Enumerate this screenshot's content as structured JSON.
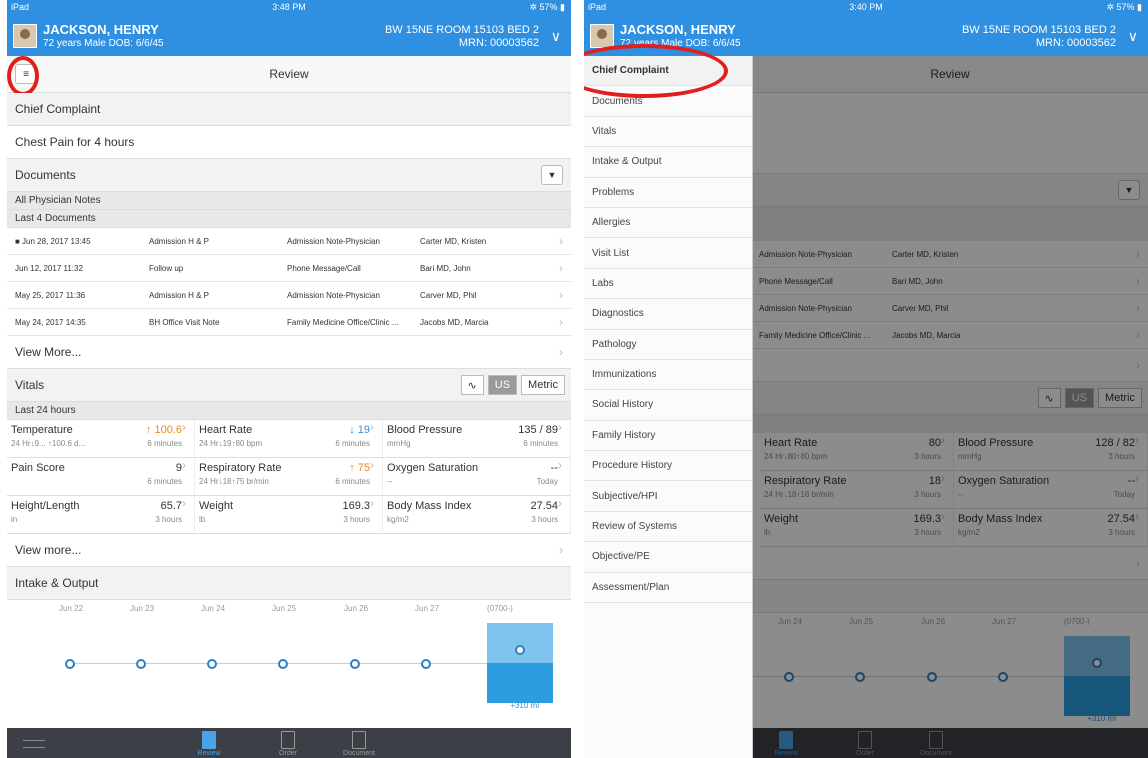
{
  "status": {
    "device": "iPad",
    "left_time": "3:48 PM",
    "right_time": "3:40 PM",
    "battery": "57%"
  },
  "patient": {
    "name": "JACKSON, HENRY",
    "info": "72 years  Male  DOB: 6/6/45",
    "room": "BW 15NE ROOM 15103 BED 2",
    "mrn": "MRN: 00003562"
  },
  "page_title": "Review",
  "chief_complaint": {
    "label": "Chief Complaint",
    "value": "Chest Pain for 4 hours"
  },
  "documents": {
    "label": "Documents",
    "filter": "All Physician Notes",
    "count": "Last 4 Documents",
    "rows": [
      {
        "date": "Jun 28, 2017 13:45",
        "type": "Admission H & P",
        "category": "Admission Note-Physician",
        "author": "Carter MD, Kristen"
      },
      {
        "date": "Jun 12, 2017 11:32",
        "type": "Follow up",
        "category": "Phone Message/Call",
        "author": "Bari MD, John"
      },
      {
        "date": "May 25, 2017 11:36",
        "type": "Admission H & P",
        "category": "Admission Note-Physician",
        "author": "Carver MD, Phil"
      },
      {
        "date": "May 24, 2017 14:35",
        "type": "BH Office Visit Note",
        "category": "Family Medicine Office/Clinic ...",
        "author": "Jacobs MD, Marcia"
      }
    ],
    "view_more": "View More..."
  },
  "vitals": {
    "label": "Vitals",
    "us": "US",
    "metric": "Metric",
    "period": "Last 24 hours",
    "cells": [
      {
        "name": "Temperature",
        "value": "100.6",
        "sub": "24 Hr↓9... ↑100.6 d...",
        "time": "6 minutes"
      },
      {
        "name": "Heart Rate",
        "value": "19",
        "sub": "24 Hr↓19↑80 bpm",
        "time": "6 minutes"
      },
      {
        "name": "Blood Pressure",
        "value": "135 / 89",
        "sub": "mmHg",
        "time": "6 minutes"
      },
      {
        "name": "Pain Score",
        "value": "9",
        "sub": "",
        "time": "6 minutes"
      },
      {
        "name": "Respiratory Rate",
        "value": "75",
        "sub": "24 Hr↓18↑75 br/min",
        "time": "6 minutes"
      },
      {
        "name": "Oxygen Saturation",
        "value": "--",
        "sub": "--",
        "time": "Today"
      },
      {
        "name": "Height/Length",
        "value": "65.7",
        "sub": "in",
        "time": "3 hours"
      },
      {
        "name": "Weight",
        "value": "169.3",
        "sub": "lb",
        "time": "3 hours"
      },
      {
        "name": "Body Mass Index",
        "value": "27.54",
        "sub": "kg/m2",
        "time": "3 hours"
      }
    ],
    "right_cells": [
      {
        "name": "Heart Rate",
        "value": "80",
        "sub": "24 Hr↓80↑80 bpm",
        "time": "3 hours"
      },
      {
        "name": "Blood Pressure",
        "value": "128 / 82",
        "sub": "mmHg",
        "time": "3 hours"
      },
      {
        "name": "Respiratory Rate",
        "value": "18",
        "sub": "24 Hr↓18↑18 br/min",
        "time": "3 hours"
      },
      {
        "name": "Oxygen Saturation",
        "value": "--",
        "sub": "--",
        "time": "Today"
      },
      {
        "name": "Weight",
        "value": "169.3",
        "sub": "lb",
        "time": "3 hours"
      },
      {
        "name": "Body Mass Index",
        "value": "27.54",
        "sub": "kg/m2",
        "time": "3 hours"
      }
    ],
    "view_more": "View more..."
  },
  "intake": {
    "label": "Intake & Output",
    "dates": [
      "Jun 22",
      "Jun 23",
      "Jun 24",
      "Jun 25",
      "Jun 26",
      "Jun 27",
      "(0700-)"
    ],
    "total": "+310 ml"
  },
  "tabs": [
    {
      "label": "Review"
    },
    {
      "label": "Order"
    },
    {
      "label": "Document"
    }
  ],
  "drawer": [
    "Chief Complaint",
    "Documents",
    "Vitals",
    "Intake & Output",
    "Problems",
    "Allergies",
    "Visit List",
    "Labs",
    "Diagnostics",
    "Pathology",
    "Immunizations",
    "Social History",
    "Family History",
    "Procedure History",
    "Subjective/HPI",
    "Review of Systems",
    "Objective/PE",
    "Assessment/Plan"
  ],
  "colors": {
    "header": "#2f8fe0",
    "highlight": "#e0201e"
  }
}
